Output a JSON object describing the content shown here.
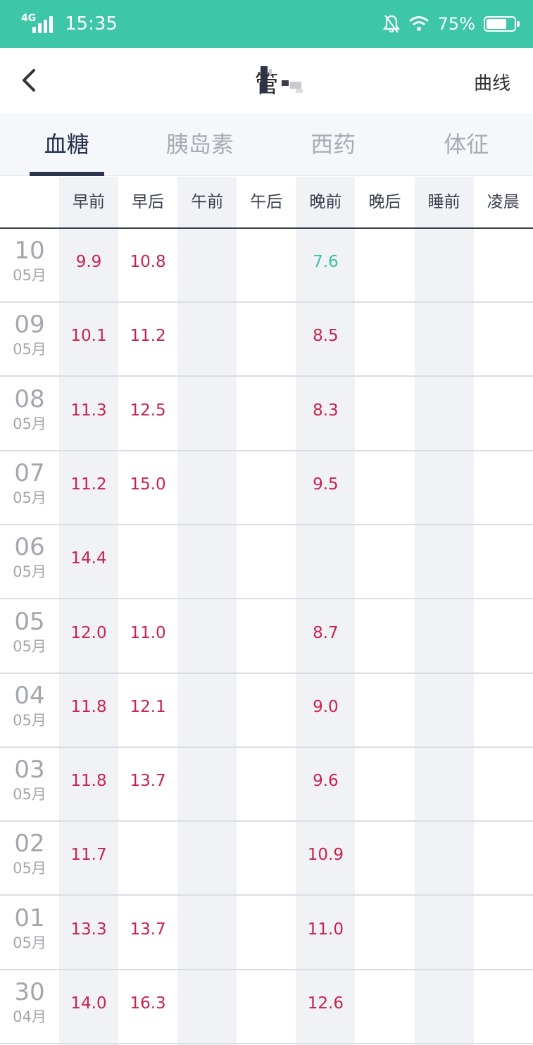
{
  "status_bar": {
    "network": "4G",
    "time": "15:35",
    "battery": "75%",
    "battery_level": 0.75
  },
  "nav": {
    "title": "管",
    "curve_label": "曲线"
  },
  "tabs": [
    "血糖",
    "胰岛素",
    "西药",
    "体征"
  ],
  "active_tab": 0,
  "columns": [
    "早前",
    "早后",
    "午前",
    "午后",
    "晚前",
    "晚后",
    "睡前",
    "凌晨"
  ],
  "rows": [
    {
      "day": "10",
      "month": "05月",
      "values": [
        "9.9",
        "10.8",
        "",
        "",
        "7.6",
        "",
        "",
        ""
      ]
    },
    {
      "day": "09",
      "month": "05月",
      "values": [
        "10.1",
        "11.2",
        "",
        "",
        "8.5",
        "",
        "",
        ""
      ]
    },
    {
      "day": "08",
      "month": "05月",
      "values": [
        "11.3",
        "12.5",
        "",
        "",
        "8.3",
        "",
        "",
        ""
      ]
    },
    {
      "day": "07",
      "month": "05月",
      "values": [
        "11.2",
        "15.0",
        "",
        "",
        "9.5",
        "",
        "",
        ""
      ]
    },
    {
      "day": "06",
      "month": "05月",
      "values": [
        "14.4",
        "",
        "",
        "",
        "",
        "",
        "",
        ""
      ]
    },
    {
      "day": "05",
      "month": "05月",
      "values": [
        "12.0",
        "11.0",
        "",
        "",
        "8.7",
        "",
        "",
        ""
      ]
    },
    {
      "day": "04",
      "month": "05月",
      "values": [
        "11.8",
        "12.1",
        "",
        "",
        "9.0",
        "",
        "",
        ""
      ]
    },
    {
      "day": "03",
      "month": "05月",
      "values": [
        "11.8",
        "13.7",
        "",
        "",
        "9.6",
        "",
        "",
        ""
      ]
    },
    {
      "day": "02",
      "month": "05月",
      "values": [
        "11.7",
        "",
        "",
        "",
        "10.9",
        "",
        "",
        ""
      ]
    },
    {
      "day": "01",
      "month": "05月",
      "values": [
        "13.3",
        "13.7",
        "",
        "",
        "11.0",
        "",
        "",
        ""
      ]
    },
    {
      "day": "30",
      "month": "04月",
      "values": [
        "14.0",
        "16.3",
        "",
        "",
        "12.6",
        "",
        "",
        ""
      ]
    }
  ],
  "normal_values": [
    "7.6"
  ],
  "colors": {
    "accent": "#3dc6a8",
    "high": "#c9234d",
    "normal": "#3fc0a6",
    "tab_active": "#25304a"
  }
}
